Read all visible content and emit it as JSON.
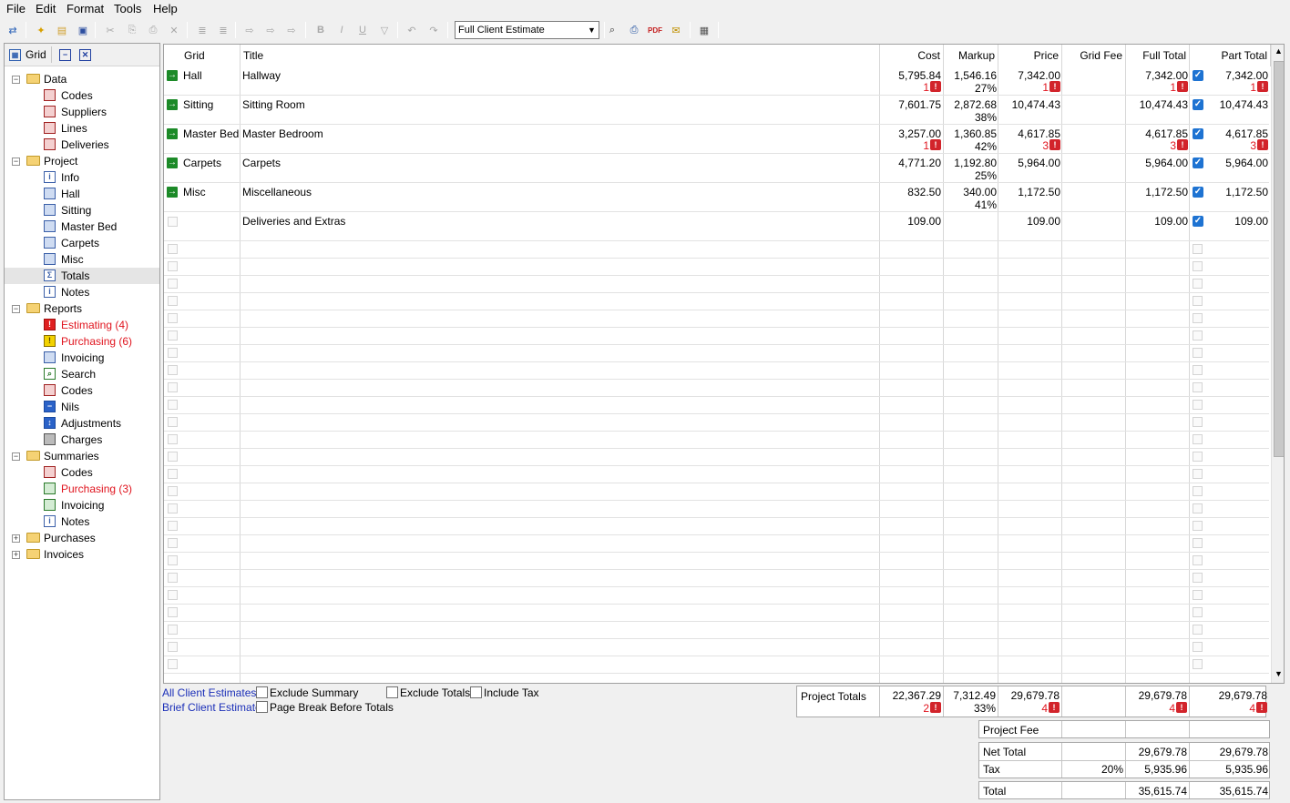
{
  "menu": {
    "file": "File",
    "edit": "Edit",
    "format": "Format",
    "tools": "Tools",
    "help": "Help"
  },
  "toolbar": {
    "report_select": "Full Client Estimate",
    "bold": "B",
    "italic": "I",
    "underline": "U"
  },
  "left_panel": {
    "title": "Grid"
  },
  "tree": {
    "data": "Data",
    "data_codes": "Codes",
    "data_suppliers": "Suppliers",
    "data_lines": "Lines",
    "data_deliveries": "Deliveries",
    "project": "Project",
    "project_info": "Info",
    "project_hall": "Hall",
    "project_sitting": "Sitting",
    "project_master_bed": "Master Bed",
    "project_carpets": "Carpets",
    "project_misc": "Misc",
    "project_totals": "Totals",
    "project_notes": "Notes",
    "reports": "Reports",
    "reports_estimating": "Estimating (4)",
    "reports_purchasing": "Purchasing (6)",
    "reports_invoicing": "Invoicing",
    "reports_search": "Search",
    "reports_codes": "Codes",
    "reports_nils": "Nils",
    "reports_adjustments": "Adjustments",
    "reports_charges": "Charges",
    "summaries": "Summaries",
    "summaries_codes": "Codes",
    "summaries_purchasing": "Purchasing (3)",
    "summaries_invoicing": "Invoicing",
    "summaries_notes": "Notes",
    "purchases": "Purchases",
    "invoices": "Invoices"
  },
  "columns": {
    "grid": "Grid",
    "title": "Title",
    "cost": "Cost",
    "markup": "Markup",
    "price": "Price",
    "grid_fee": "Grid Fee",
    "full_total": "Full Total",
    "part_total": "Part Total"
  },
  "rows": [
    {
      "grid": "Hall",
      "title": "Hallway",
      "cost": "5,795.84",
      "cost_warn": "1",
      "markup": "1,546.16",
      "markup_pct": "27%",
      "price": "7,342.00",
      "price_warn": "1",
      "full_total": "7,342.00",
      "full_warn": "1",
      "part_total": "7,342.00",
      "part_warn": "1"
    },
    {
      "grid": "Sitting",
      "title": "Sitting Room",
      "cost": "7,601.75",
      "cost_warn": "",
      "markup": "2,872.68",
      "markup_pct": "38%",
      "price": "10,474.43",
      "price_warn": "",
      "full_total": "10,474.43",
      "full_warn": "",
      "part_total": "10,474.43",
      "part_warn": ""
    },
    {
      "grid": "Master Bed",
      "title": "Master Bedroom",
      "cost": "3,257.00",
      "cost_warn": "1",
      "markup": "1,360.85",
      "markup_pct": "42%",
      "price": "4,617.85",
      "price_warn": "3",
      "full_total": "4,617.85",
      "full_warn": "3",
      "part_total": "4,617.85",
      "part_warn": "3"
    },
    {
      "grid": "Carpets",
      "title": "Carpets",
      "cost": "4,771.20",
      "cost_warn": "",
      "markup": "1,192.80",
      "markup_pct": "25%",
      "price": "5,964.00",
      "price_warn": "",
      "full_total": "5,964.00",
      "full_warn": "",
      "part_total": "5,964.00",
      "part_warn": ""
    },
    {
      "grid": "Misc",
      "title": "Miscellaneous",
      "cost": "832.50",
      "cost_warn": "",
      "markup": "340.00",
      "markup_pct": "41%",
      "price": "1,172.50",
      "price_warn": "",
      "full_total": "1,172.50",
      "full_warn": "",
      "part_total": "1,172.50",
      "part_warn": ""
    },
    {
      "grid": "",
      "title": "Deliveries and Extras",
      "cost": "109.00",
      "cost_warn": "",
      "markup": "",
      "markup_pct": "",
      "price": "109.00",
      "price_warn": "",
      "full_total": "109.00",
      "full_warn": "",
      "part_total": "109.00",
      "part_warn": ""
    }
  ],
  "footer": {
    "all_client_estimates": "All Client Estimates",
    "brief_client_estimate": "Brief Client Estimate",
    "exclude_summary": "Exclude Summary",
    "page_break": "Page Break Before Totals",
    "exclude_totals": "Exclude Totals",
    "include_tax": "Include Tax"
  },
  "project_totals": {
    "label": "Project Totals",
    "cost": "22,367.29",
    "cost_warn": "2",
    "markup": "7,312.49",
    "markup_pct": "33%",
    "price": "29,679.78",
    "price_warn": "4",
    "full_total": "29,679.78",
    "full_warn": "4",
    "part_total": "29,679.78",
    "part_warn": "4"
  },
  "summary": {
    "project_fee": "Project Fee",
    "net_total": "Net Total",
    "net_full": "29,679.78",
    "net_part": "29,679.78",
    "tax": "Tax",
    "tax_rate": "20%",
    "tax_full": "5,935.96",
    "tax_part": "5,935.96",
    "total": "Total",
    "total_full": "35,615.74",
    "total_part": "35,615.74"
  }
}
